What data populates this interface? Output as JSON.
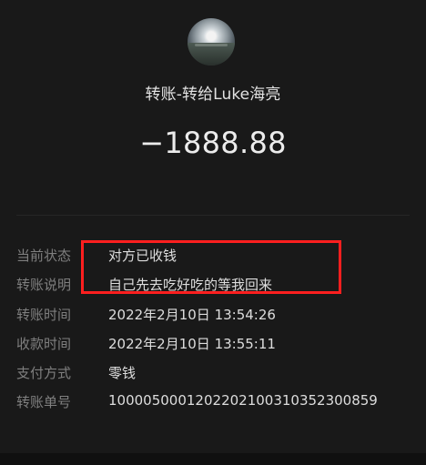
{
  "header": {
    "title": "转账-转给Luke海亮",
    "amount": "−1888.88"
  },
  "details": [
    {
      "label": "当前状态",
      "value": "对方已收钱"
    },
    {
      "label": "转账说明",
      "value": "自己先去吃好吃的等我回来"
    },
    {
      "label": "转账时间",
      "value": "2022年2月10日 13:54:26"
    },
    {
      "label": "收款时间",
      "value": "2022年2月10日 13:55:11"
    },
    {
      "label": "支付方式",
      "value": "零钱"
    },
    {
      "label": "转账单号",
      "value": "100005000120220210031035230085​9"
    }
  ],
  "colors": {
    "background": "#191919",
    "highlight": "#ff1f1f",
    "label": "#7f7f7f",
    "value": "#dddddd"
  }
}
